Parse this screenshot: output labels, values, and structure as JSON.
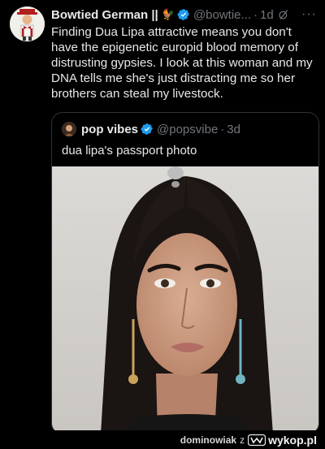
{
  "tweet": {
    "author_name": "Bowtied German ||",
    "author_emoji": "🐓",
    "handle": "@bowtie...",
    "separator": "·",
    "time": "1d",
    "more": "···",
    "text": "Finding Dua Lipa attractive means you don't have the epigenetic europid blood memory of distrusting gypsies.  I look at this woman and my DNA tells me she's just distracting me so her brothers can steal my livestock."
  },
  "quote": {
    "author_name": "pop vibes",
    "handle": "@popsvibe",
    "separator": "·",
    "time": "3d",
    "text": "dua lipa's passport photo"
  },
  "footer": {
    "user": "dominowiak",
    "z_label": "z",
    "site": "wykop.pl"
  },
  "colors": {
    "background": "#000000",
    "text": "#e7e9ea",
    "muted": "#71767b",
    "verified": "#1d9bf0",
    "border": "#2f3336"
  },
  "icons": [
    "avatar",
    "verified-badge-icon",
    "grok-icon",
    "more-icon",
    "wykop-logo-icon"
  ]
}
